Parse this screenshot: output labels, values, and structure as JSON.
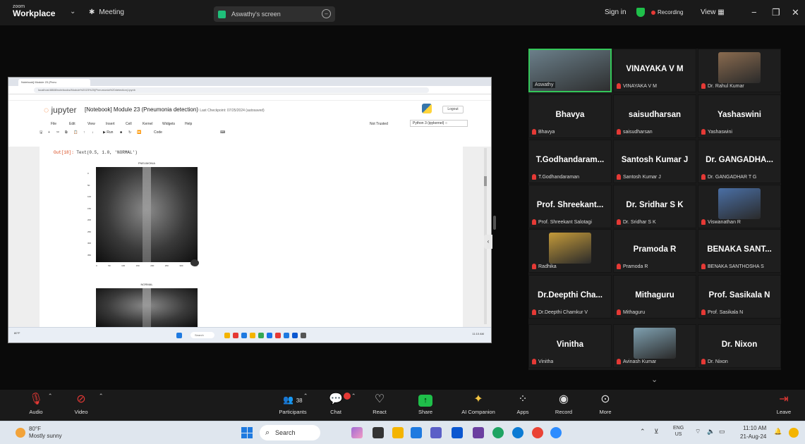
{
  "window": {
    "brand_small": "zoom",
    "brand_name": "Workplace",
    "meeting_label": "Meeting",
    "share_label": "Aswathy's screen",
    "sign_in": "Sign in",
    "recording": "Recording",
    "view": "View"
  },
  "shared": {
    "browser_tab": "Notebook] Module 23 (Pneu",
    "url": "localhost:8888/notebooks/Module%2023%20(Pneumonia%20detection).ipynb",
    "jupyter_logo": "jupyter",
    "notebook_title": "[Notebook] Module 23 (Pneumonia detection)",
    "checkpoint": "Last Checkpoint: 07/25/2024 (autosaved)",
    "logout": "Logout",
    "trusted": "Not Trusted",
    "kernel": "Python 3 (ipykernel) ○",
    "menu": [
      "File",
      "Edit",
      "View",
      "Insert",
      "Cell",
      "Kernel",
      "Widgets",
      "Help"
    ],
    "toolbar_run": "▶ Run",
    "toolbar_celltype": "Code",
    "code_prompt": "Out[18]:",
    "code_text": "Text(0.5, 1.0, 'NORMAL')",
    "plot1_title": "PNEUMONIA",
    "plot2_title": "NORMAL",
    "y_ticks": [
      "0",
      "50",
      "100",
      "150",
      "200",
      "250",
      "300",
      "350"
    ],
    "x_ticks": [
      "0",
      "50",
      "100",
      "150",
      "200",
      "250",
      "300",
      "350"
    ],
    "inner_search": "Search",
    "inner_weather": "80°F",
    "inner_clock": "11:10 AM"
  },
  "gallery": {
    "tiles": [
      {
        "big": "",
        "small": "Aswathy",
        "photo": true,
        "active": true
      },
      {
        "big": "VINAYAKA V M",
        "small": "VINAYAKA V M"
      },
      {
        "big": "",
        "small": "Dr. Rahul Kumar",
        "photo": true
      },
      {
        "big": "Bhavya",
        "small": "Bhavya"
      },
      {
        "big": "saisudharsan",
        "small": "saisudharsan"
      },
      {
        "big": "Yashaswini",
        "small": "Yashaswini"
      },
      {
        "big": "T.Godhandaram...",
        "small": "T.Godhandaraman"
      },
      {
        "big": "Santosh Kumar J",
        "small": "Santosh Kumar J"
      },
      {
        "big": "Dr. GANGADHA...",
        "small": "Dr. GANGADHAR T G"
      },
      {
        "big": "Prof. Shreekant...",
        "small": "Prof. Shreekant Salotagi"
      },
      {
        "big": "Dr. Sridhar S K",
        "small": "Dr. Sridhar S K"
      },
      {
        "big": "",
        "small": "Viswanathan R",
        "photo": true
      },
      {
        "big": "",
        "small": "Radhika",
        "photo": true
      },
      {
        "big": "Pramoda R",
        "small": "Pramoda R"
      },
      {
        "big": "BENAKA SANT...",
        "small": "BENAKA SANTHOSHA S"
      },
      {
        "big": "Dr.Deepthi Cha...",
        "small": "Dr.Deepthi Chamkur V"
      },
      {
        "big": "Mithaguru",
        "small": "Mithaguru"
      },
      {
        "big": "Prof. Sasikala N",
        "small": "Prof. Sasikala N"
      },
      {
        "big": "Vinitha",
        "small": "Vinitha"
      },
      {
        "big": "",
        "small": "Avinash Kumar",
        "photo": true
      },
      {
        "big": "Dr. Nixon",
        "small": "Dr. Nixon"
      }
    ]
  },
  "controls": {
    "audio": "Audio",
    "video": "Video",
    "participants": "Participants",
    "participants_count": "38",
    "chat": "Chat",
    "react": "React",
    "share": "Share",
    "ai": "AI Companion",
    "apps": "Apps",
    "record": "Record",
    "more": "More",
    "leave": "Leave"
  },
  "taskbar": {
    "weather_temp": "80°F",
    "weather_desc": "Mostly sunny",
    "search": "Search",
    "lang1": "ENG",
    "lang2": "US",
    "time": "11:10 AM",
    "date": "21-Aug-24"
  },
  "colors": {
    "accent_green": "#34c759",
    "mic_off_red": "#e53935",
    "zoom_bg": "#1a1a1a"
  }
}
